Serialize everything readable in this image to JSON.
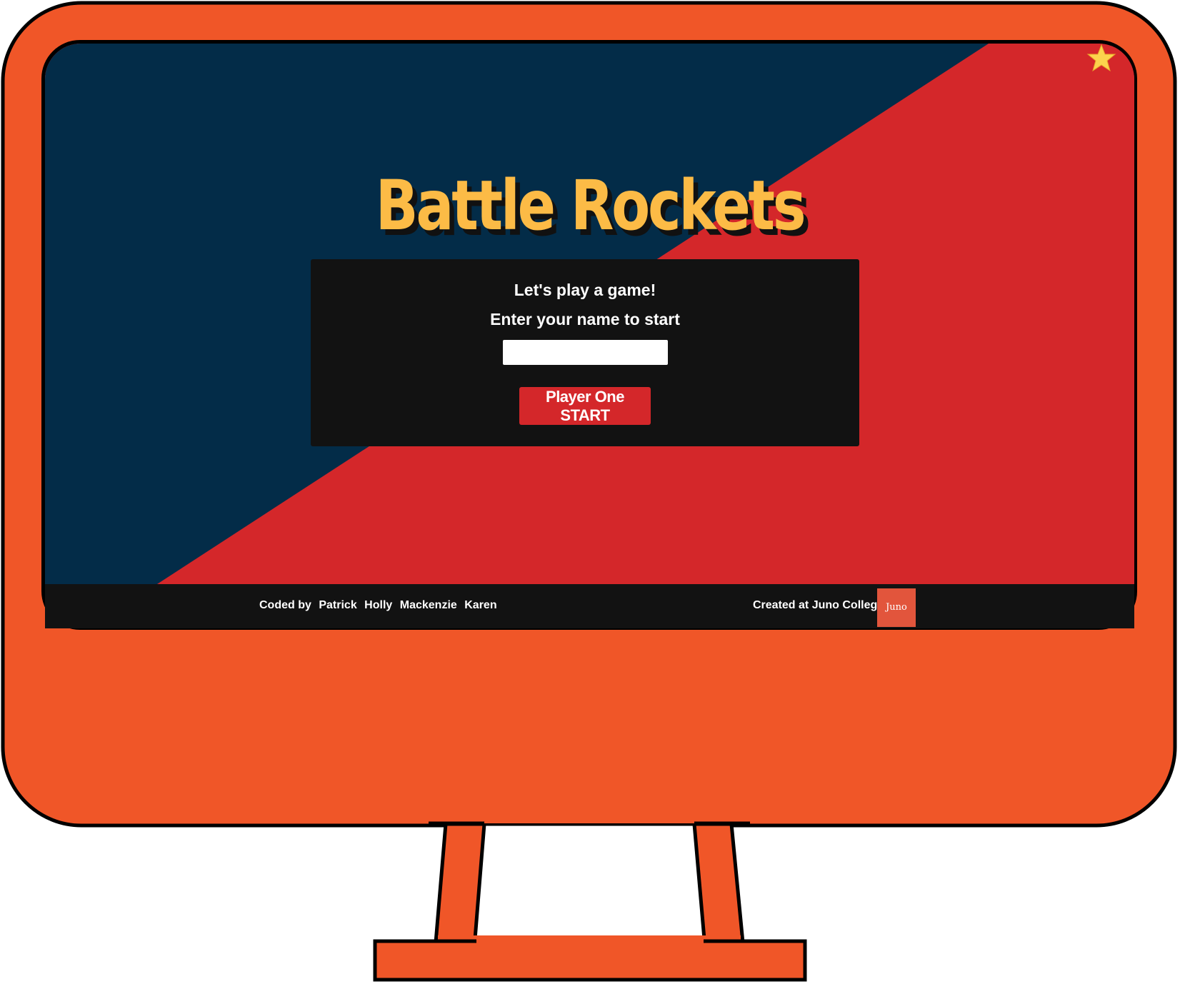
{
  "colors": {
    "monitor_body": "#f05628",
    "monitor_outline": "#000000",
    "screen_navy": "#032c48",
    "screen_red": "#d4272a",
    "title_yellow": "#fcbb46",
    "panel_black": "#121212",
    "button_red": "#d4272a",
    "juno_badge": "#e2553c",
    "star": "#fcd34d"
  },
  "game": {
    "title": "Battle Rockets"
  },
  "panel": {
    "greeting": "Let's play a game!",
    "prompt": "Enter your name to start",
    "name_input_value": "",
    "start_button_label": "Player One START"
  },
  "footer": {
    "coded_by_label": "Coded by",
    "authors": [
      "Patrick",
      "Holly",
      "Mackenzie",
      "Karen"
    ],
    "created_at": "Created at Juno College",
    "juno_badge_label": "Juno"
  },
  "icons": {
    "corner_decoration": "star-icon"
  }
}
